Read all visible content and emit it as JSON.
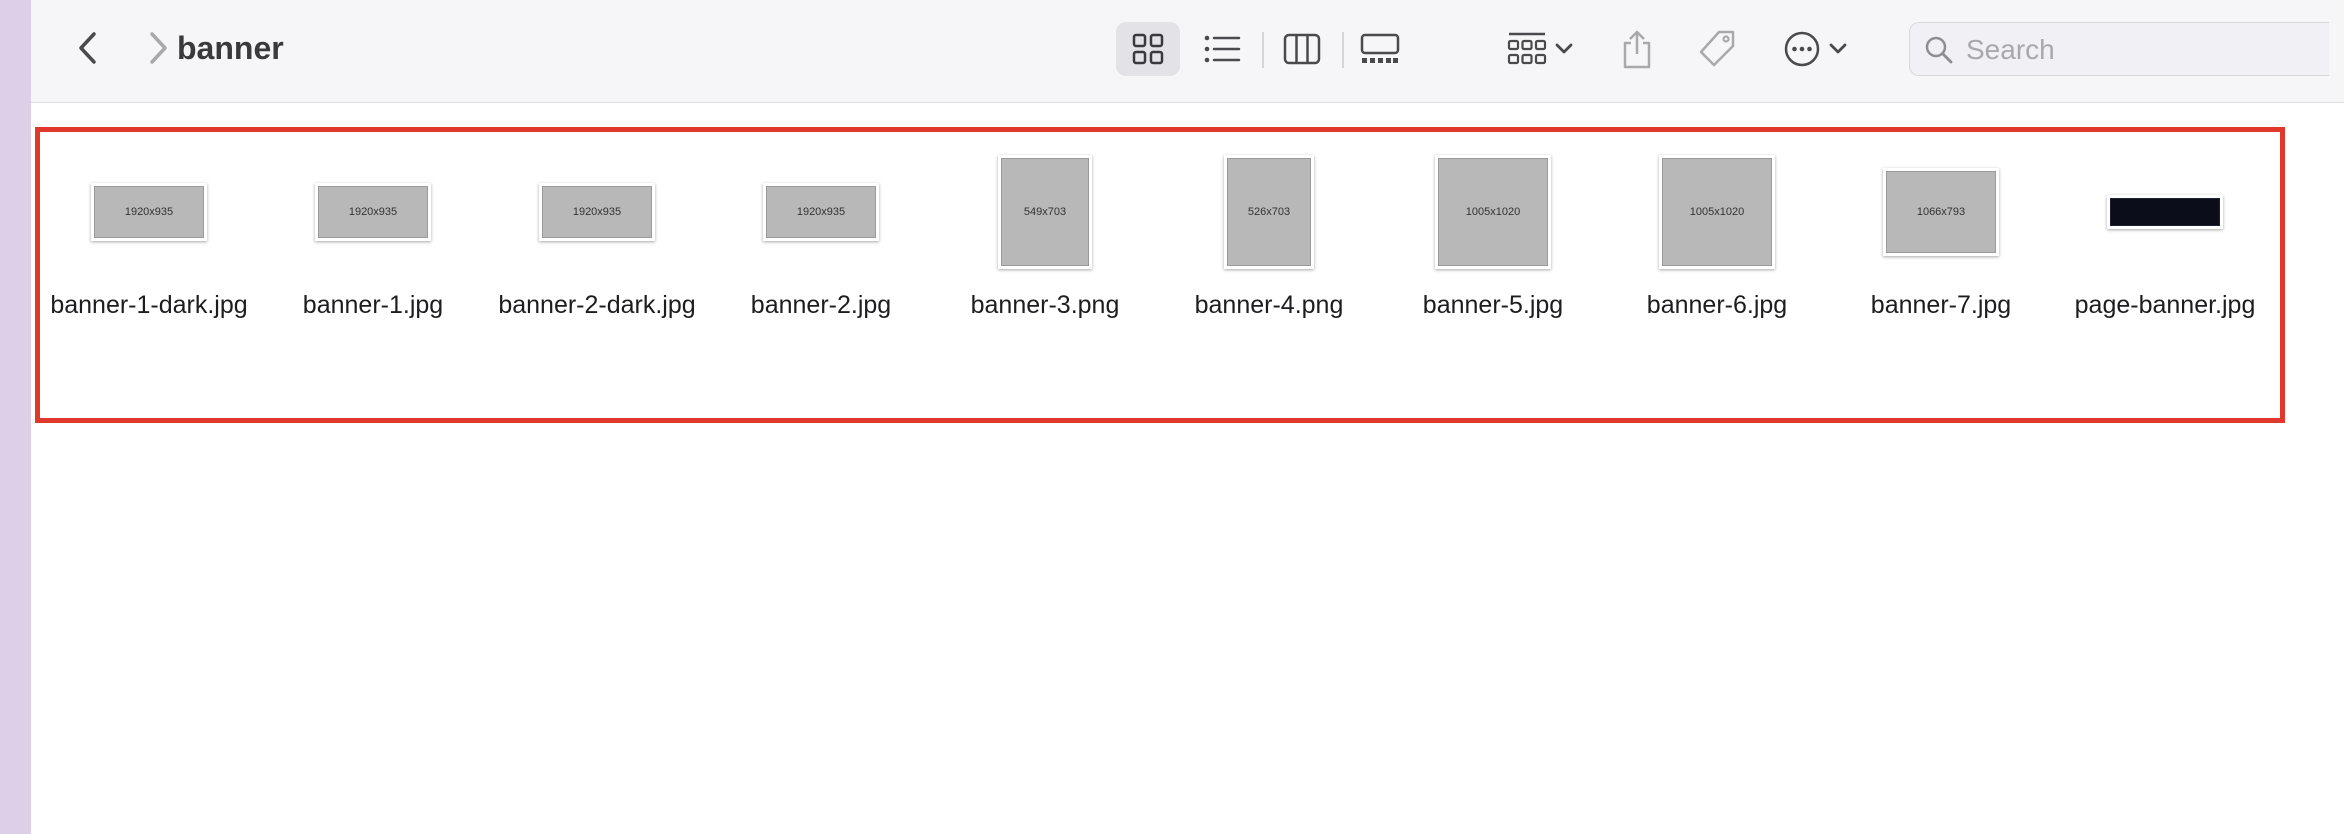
{
  "toolbar": {
    "title": "banner",
    "search_placeholder": "Search"
  },
  "files": [
    {
      "name": "banner-1-dark.jpg",
      "thumb_label": "1920x935"
    },
    {
      "name": "banner-1.jpg",
      "thumb_label": "1920x935"
    },
    {
      "name": "banner-2-dark.jpg",
      "thumb_label": "1920x935"
    },
    {
      "name": "banner-2.jpg",
      "thumb_label": "1920x935"
    },
    {
      "name": "banner-3.png",
      "thumb_label": "549x703"
    },
    {
      "name": "banner-4.png",
      "thumb_label": "526x703"
    },
    {
      "name": "banner-5.jpg",
      "thumb_label": "1005x1020"
    },
    {
      "name": "banner-6.jpg",
      "thumb_label": "1005x1020"
    },
    {
      "name": "banner-7.jpg",
      "thumb_label": "1066x793"
    },
    {
      "name": "page-banner.jpg",
      "thumb_label": ""
    }
  ],
  "colors": {
    "selection": "#e0382d",
    "toolbar_bg": "#f6f5f8",
    "sidebar_strip": "#dcd0e8"
  }
}
